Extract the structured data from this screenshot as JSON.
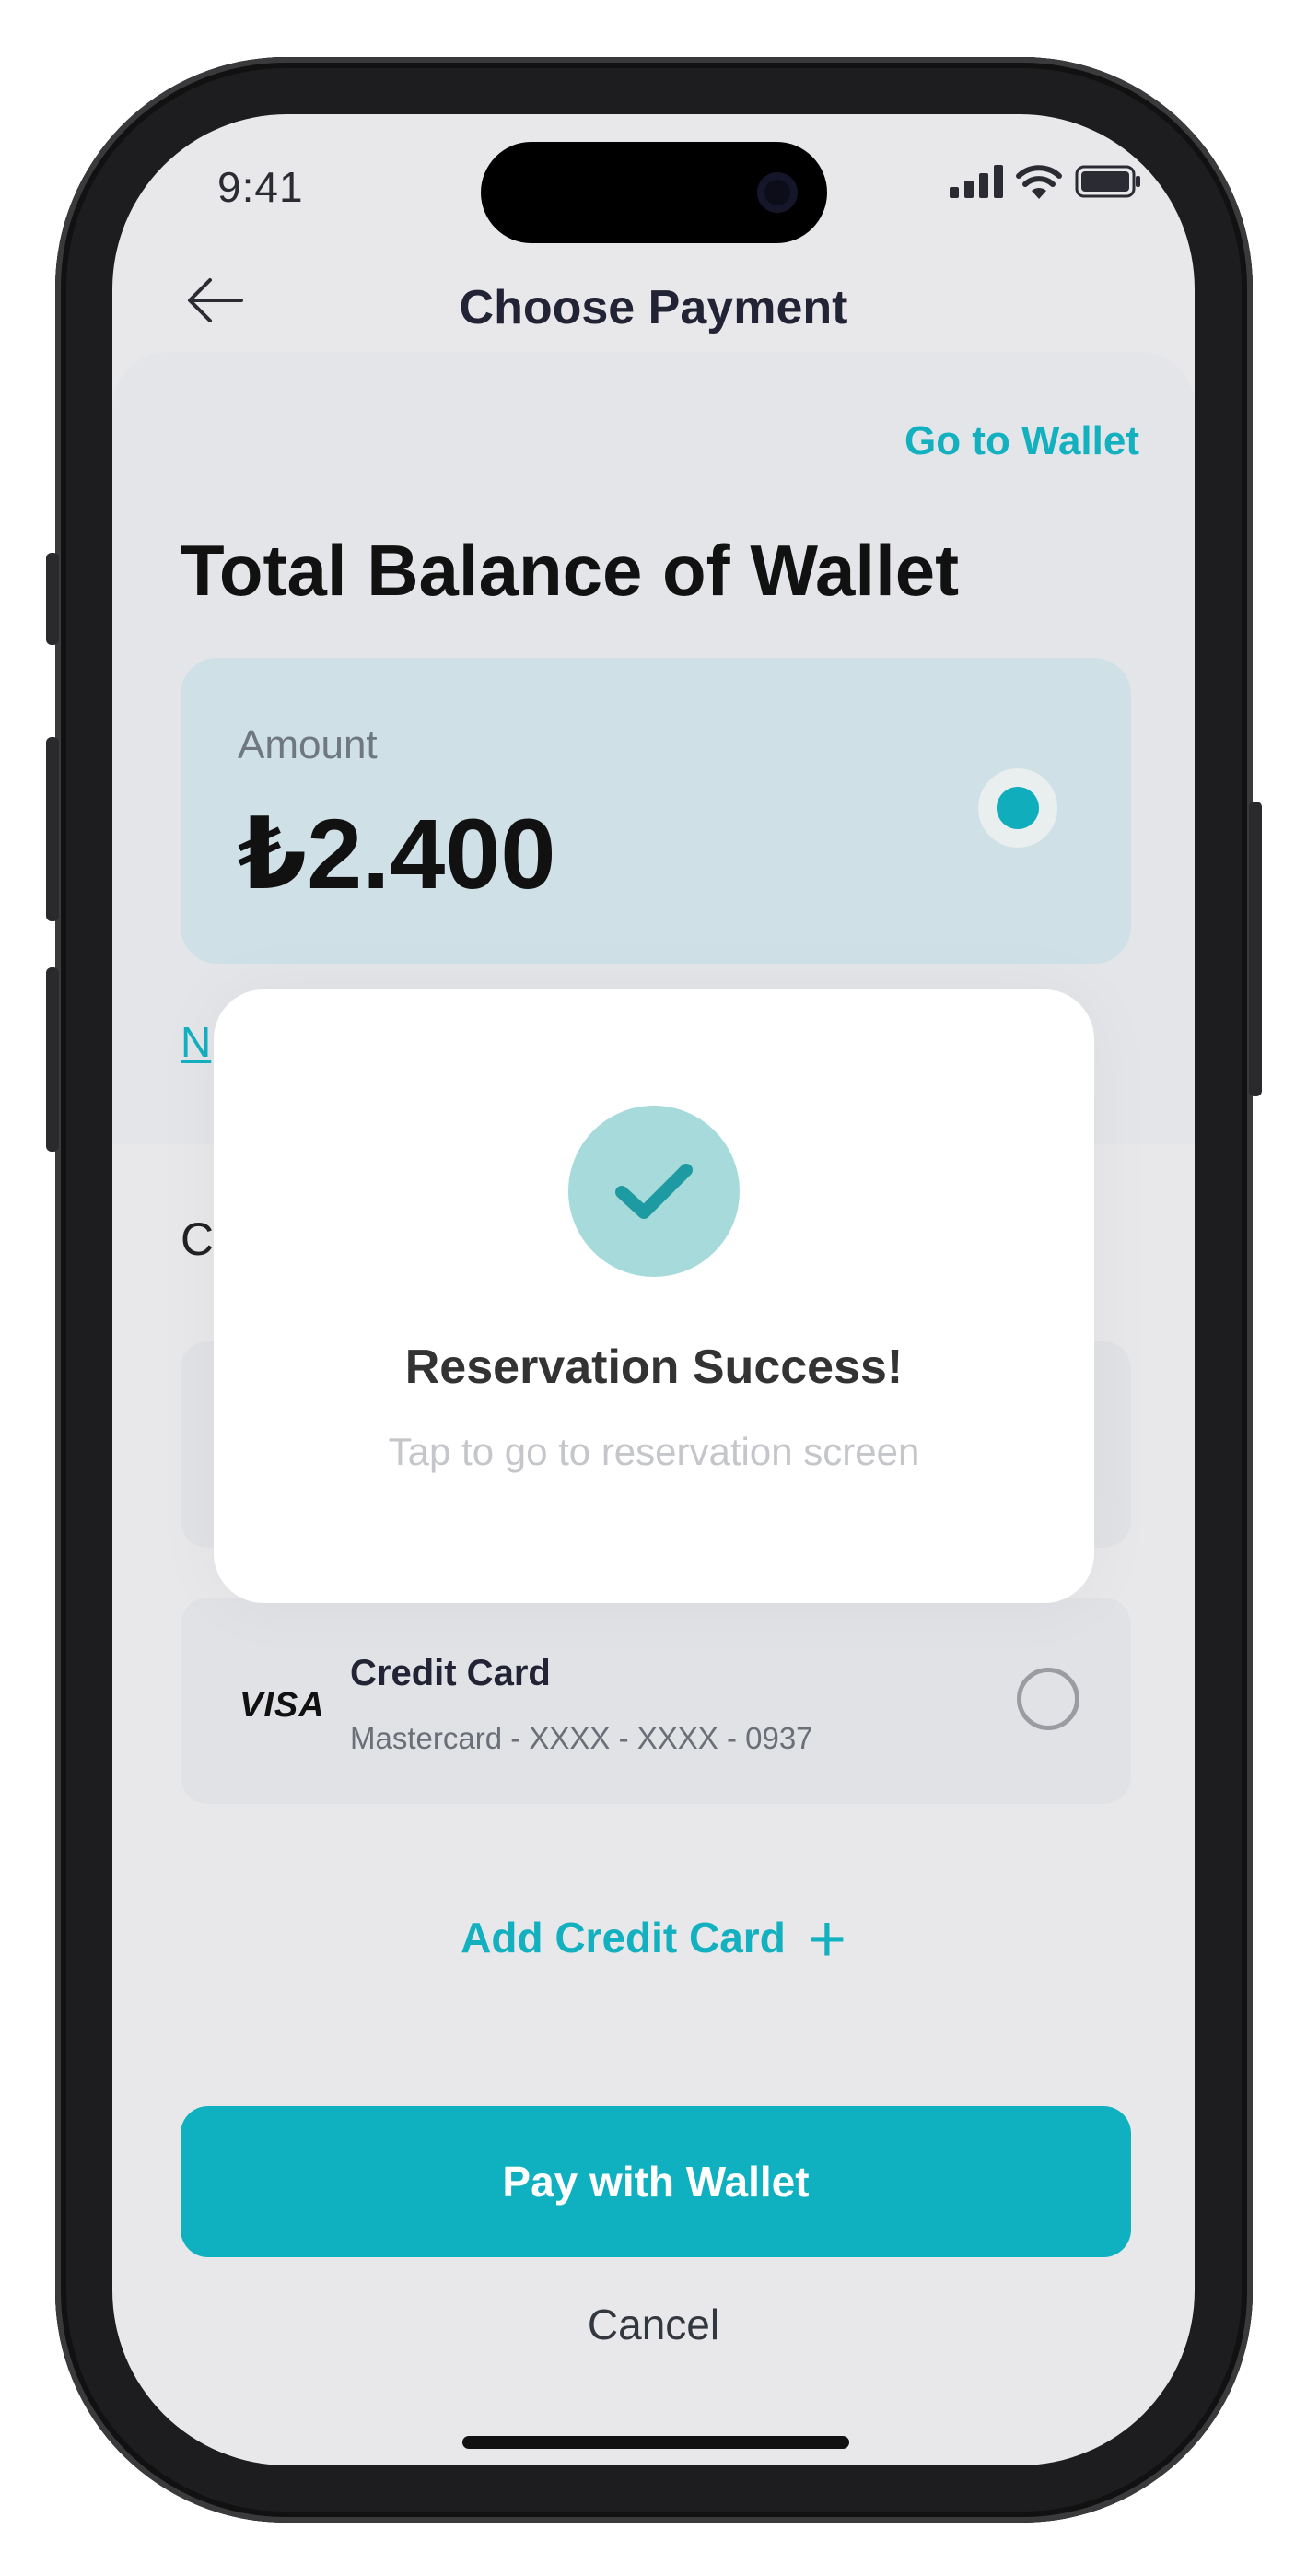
{
  "status_bar": {
    "time": "9:41"
  },
  "header": {
    "title": "Choose Payment"
  },
  "wallet": {
    "goto_label": "Go to Wallet",
    "section_title": "Total Balance of Wallet",
    "amount_label": "Amount",
    "amount_value": "₺2.400",
    "selected": true
  },
  "background_partial": {
    "link_fragment": "N",
    "heading_fragment": "C"
  },
  "credit_card": {
    "brand": "VISA",
    "title": "Credit Card",
    "subtitle": "Mastercard - XXXX - XXXX  - 0937",
    "selected": false
  },
  "add_card_label": "Add Credit Card",
  "pay_button_label": "Pay with Wallet",
  "cancel_label": "Cancel",
  "modal": {
    "title": "Reservation Success!",
    "subtitle": "Tap to go to reservation screen"
  },
  "colors": {
    "accent": "#0fb0bf",
    "amount_card": "#cfe1e6",
    "success_circle": "#a6dadb",
    "check": "#1e9aa2"
  }
}
